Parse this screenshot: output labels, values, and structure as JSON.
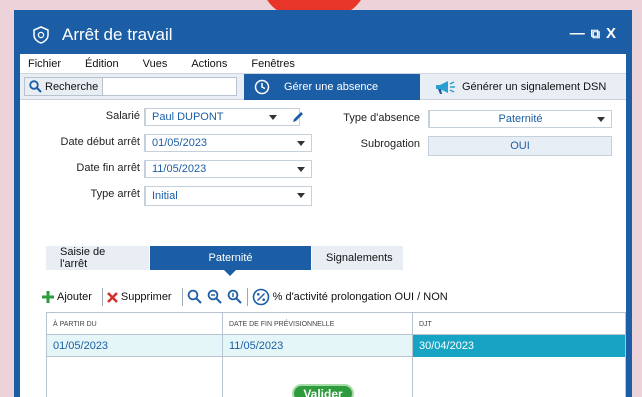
{
  "window": {
    "title": "Arrêt de travail",
    "controls": [
      "—",
      "⧉",
      "X"
    ]
  },
  "menu": [
    "Fichier",
    "Édition",
    "Vues",
    "Actions",
    "Fenêtres"
  ],
  "toolbar": {
    "search_label": "Recherche",
    "search_value": "",
    "tab_absence": "Gérer une absence",
    "tab_dsn": "Générer un signalement DSN"
  },
  "form": {
    "salarie": {
      "label": "Salarié",
      "value": "Paul DUPONT"
    },
    "date_debut": {
      "label": "Date début arrêt",
      "value": "01/05/2023"
    },
    "date_fin": {
      "label": "Date fin arrêt",
      "value": "11/05/2023"
    },
    "type_arret": {
      "label": "Type arrêt",
      "value": "Initial"
    },
    "type_absence": {
      "label": "Type d'absence",
      "value": "Paternité"
    },
    "subrogation": {
      "label": "Subrogation",
      "value": "OUI"
    }
  },
  "subtabs": [
    "Saisie de l'arrêt",
    "Paternité",
    "Signalements"
  ],
  "actions": {
    "add": "Ajouter",
    "delete": "Supprimer",
    "prolongation": "% d'activité prolongation OUI / NON"
  },
  "grid": {
    "headers": [
      "À PARTIR DU",
      "DATE DE FIN PRÉVISIONNELLE",
      "DJT"
    ],
    "rows": [
      [
        "01/05/2023",
        "11/05/2023",
        "30/04/2023"
      ]
    ]
  },
  "validate_label": "Valider",
  "colors": {
    "primary": "#1c5ea5",
    "highlight": "#16a3c4",
    "validate": "#2e9b3c",
    "delete": "#d3302a",
    "add": "#2e9b3c"
  },
  "icons": [
    "shield-icon",
    "search-icon",
    "clock-icon",
    "megaphone-icon",
    "pencil-icon",
    "plus-icon",
    "cross-icon",
    "filter-search-icons",
    "percent-icon"
  ]
}
